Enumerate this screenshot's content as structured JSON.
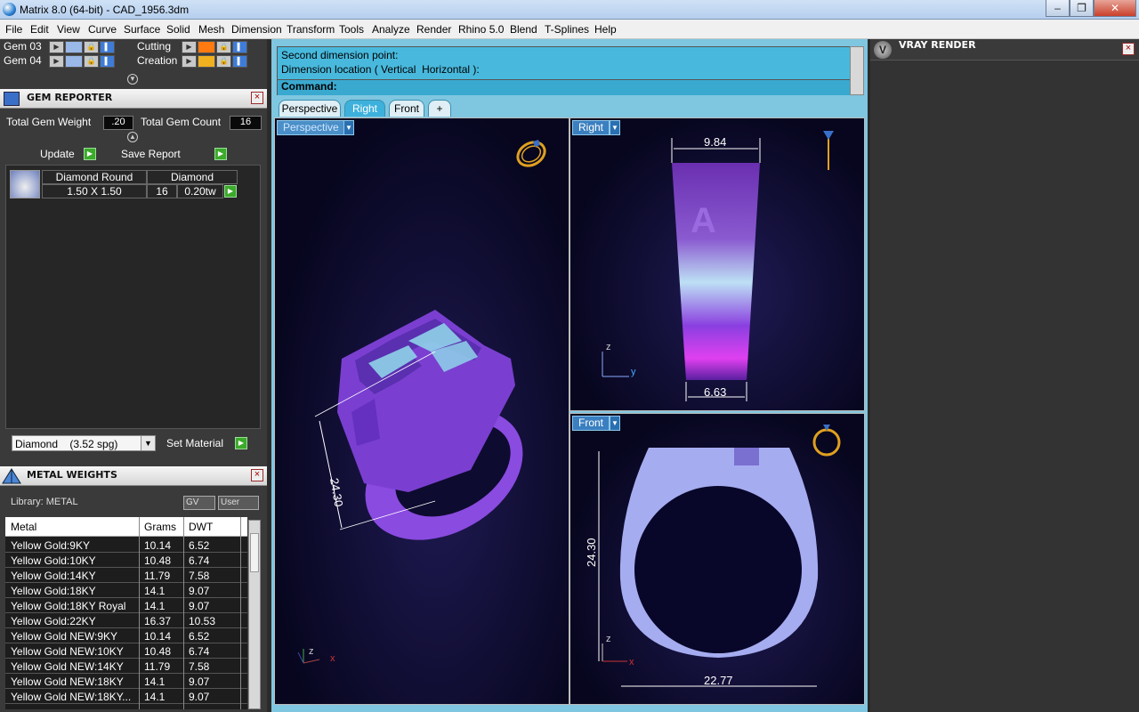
{
  "window": {
    "title": "Matrix 8.0 (64-bit) - CAD_1956.3dm",
    "min": "‒",
    "max": "❐",
    "close": "✕"
  },
  "menu": [
    "File",
    "Edit",
    "View",
    "Curve",
    "Surface",
    "Solid",
    "Mesh",
    "Dimension",
    "Transform",
    "Tools",
    "Analyze",
    "Render",
    "Rhino 5.0",
    "Blend",
    "T-Splines",
    "Help"
  ],
  "layers": {
    "gem03": "Gem 03",
    "gem04": "Gem 04",
    "cutting": "Cutting",
    "creation": "Creation"
  },
  "gem_reporter": {
    "title": "GEM REPORTER",
    "total_weight_label": "Total Gem Weight",
    "total_weight_value": ".20",
    "total_count_label": "Total Gem Count",
    "total_count_value": "16",
    "update_label": "Update",
    "save_report_label": "Save Report",
    "row": {
      "shape": "Diamond Round",
      "type": "Diamond",
      "size": "1.50 X 1.50",
      "count": "16",
      "weight": "0.20tw"
    },
    "material_select": "Diamond    (3.52 spg)",
    "set_material_label": "Set Material"
  },
  "metal_weights": {
    "title": "METAL WEIGHTS",
    "library": "Library: METAL",
    "gv": "GV",
    "user": "User",
    "columns": [
      "Metal",
      "Grams",
      "DWT"
    ],
    "rows": [
      [
        "Yellow Gold:9KY",
        "10.14",
        "6.52"
      ],
      [
        "Yellow Gold:10KY",
        "10.48",
        "6.74"
      ],
      [
        "Yellow Gold:14KY",
        "11.79",
        "7.58"
      ],
      [
        "Yellow Gold:18KY",
        "14.1",
        "9.07"
      ],
      [
        "Yellow Gold:18KY Royal",
        "14.1",
        "9.07"
      ],
      [
        "Yellow Gold:22KY",
        "16.37",
        "10.53"
      ],
      [
        "Yellow Gold NEW:9KY",
        "10.14",
        "6.52"
      ],
      [
        "Yellow Gold NEW:10KY",
        "10.48",
        "6.74"
      ],
      [
        "Yellow Gold NEW:14KY",
        "11.79",
        "7.58"
      ],
      [
        "Yellow Gold NEW:18KY",
        "14.1",
        "9.07"
      ],
      [
        "Yellow Gold NEW:18KY...",
        "14.1",
        "9.07"
      ]
    ]
  },
  "command": {
    "line1": "Second dimension point:",
    "line2": "Dimension location ( Vertical  Horizontal ):",
    "prompt": "Command:"
  },
  "tabs": [
    "Perspective",
    "Right",
    "Front",
    "+"
  ],
  "viewports": {
    "perspective": {
      "label": "Perspective",
      "dim": "24.30"
    },
    "right": {
      "label": "Right",
      "dim_top": "9.84",
      "dim_bottom": "6.63"
    },
    "front": {
      "label": "Front",
      "dim_height": "24.30",
      "dim_width": "22.77"
    }
  },
  "axes": {
    "x": "x",
    "y": "y",
    "z": "z"
  },
  "vray": {
    "title": "VRAY RENDER"
  },
  "colors": {
    "accent": "#3db1dc",
    "ring_purple": "#7a3fd0",
    "gem_blue": "#8fd3ea"
  }
}
